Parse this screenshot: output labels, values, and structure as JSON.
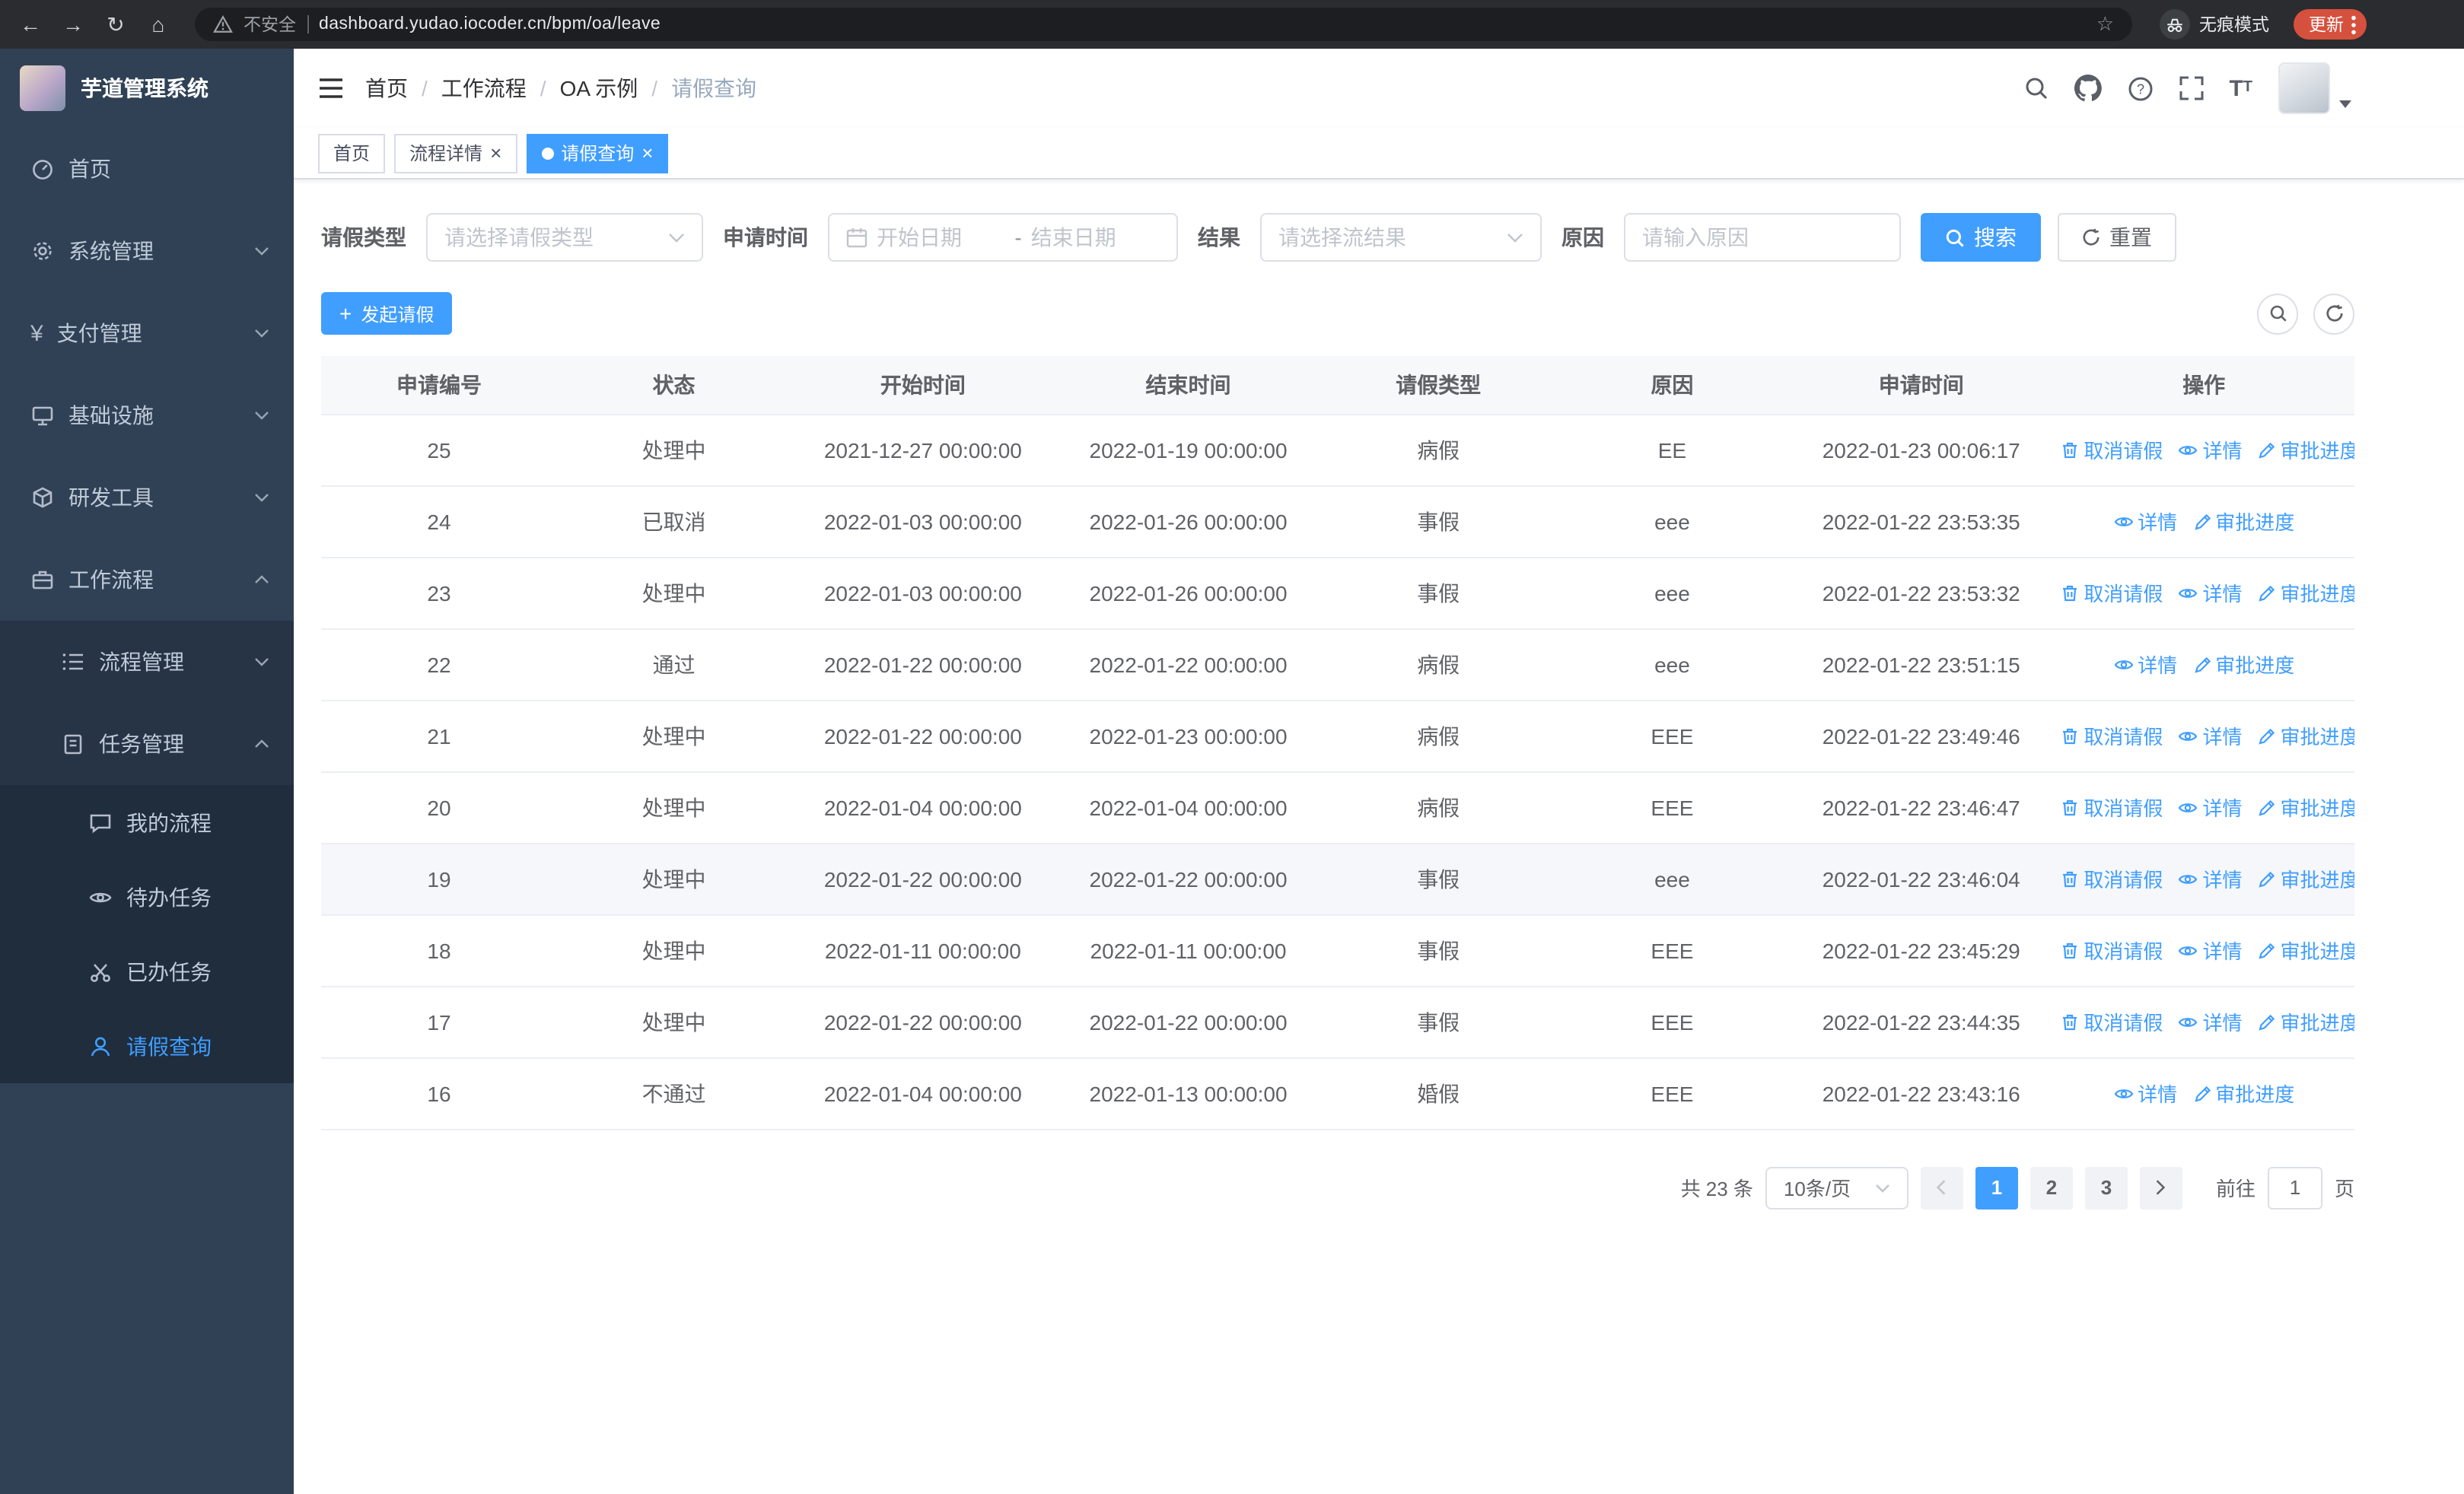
{
  "colors": {
    "accent": "#409eff",
    "sidebar_bg": "#304156",
    "sidebar_submenu_bg": "#263445",
    "sidebar_subsub_bg": "#1f2d3d",
    "update_pill": "#d6503e",
    "table_header_bg": "#f7f8fa"
  },
  "browser": {
    "security_label": "不安全",
    "url": "dashboard.yudao.iocoder.cn/bpm/oa/leave",
    "incognito_label": "无痕模式",
    "update_label": "更新"
  },
  "sidebar": {
    "logo_title": "芋道管理系统",
    "items": [
      {
        "label": "首页"
      },
      {
        "label": "系统管理"
      },
      {
        "label": "支付管理"
      },
      {
        "label": "基础设施"
      },
      {
        "label": "研发工具"
      },
      {
        "label": "工作流程"
      }
    ],
    "workflow_children": [
      {
        "label": "流程管理"
      },
      {
        "label": "任务管理"
      }
    ],
    "task_children": [
      {
        "label": "我的流程"
      },
      {
        "label": "待办任务"
      },
      {
        "label": "已办任务"
      },
      {
        "label": "请假查询"
      }
    ]
  },
  "header": {
    "breadcrumb": [
      "首页",
      "工作流程",
      "OA 示例",
      "请假查询"
    ]
  },
  "tabs": [
    {
      "label": "首页"
    },
    {
      "label": "流程详情"
    },
    {
      "label": "请假查询"
    }
  ],
  "filters": {
    "leave_type_label": "请假类型",
    "leave_type_placeholder": "请选择请假类型",
    "apply_time_label": "申请时间",
    "start_date_placeholder": "开始日期",
    "date_separator": "-",
    "end_date_placeholder": "结束日期",
    "result_label": "结果",
    "result_placeholder": "请选择流结果",
    "reason_label": "原因",
    "reason_placeholder": "请输入原因",
    "search_button": "搜索",
    "reset_button": "重置"
  },
  "toolbar": {
    "create_button": "发起请假"
  },
  "table": {
    "columns": [
      "申请编号",
      "状态",
      "开始时间",
      "结束时间",
      "请假类型",
      "原因",
      "申请时间",
      "操作"
    ],
    "action_labels": {
      "cancel": "取消请假",
      "detail": "详情",
      "progress": "审批进度"
    },
    "rows": [
      {
        "id": "25",
        "status": "处理中",
        "start": "2021-12-27 00:00:00",
        "end": "2022-01-19 00:00:00",
        "type": "病假",
        "reason": "EE",
        "applied": "2022-01-23 00:06:17",
        "actions": [
          "cancel",
          "detail",
          "progress"
        ],
        "highlighted": false
      },
      {
        "id": "24",
        "status": "已取消",
        "start": "2022-01-03 00:00:00",
        "end": "2022-01-26 00:00:00",
        "type": "事假",
        "reason": "eee",
        "applied": "2022-01-22 23:53:35",
        "actions": [
          "detail",
          "progress"
        ],
        "highlighted": false
      },
      {
        "id": "23",
        "status": "处理中",
        "start": "2022-01-03 00:00:00",
        "end": "2022-01-26 00:00:00",
        "type": "事假",
        "reason": "eee",
        "applied": "2022-01-22 23:53:32",
        "actions": [
          "cancel",
          "detail",
          "progress"
        ],
        "highlighted": false
      },
      {
        "id": "22",
        "status": "通过",
        "start": "2022-01-22 00:00:00",
        "end": "2022-01-22 00:00:00",
        "type": "病假",
        "reason": "eee",
        "applied": "2022-01-22 23:51:15",
        "actions": [
          "detail",
          "progress"
        ],
        "highlighted": false
      },
      {
        "id": "21",
        "status": "处理中",
        "start": "2022-01-22 00:00:00",
        "end": "2022-01-23 00:00:00",
        "type": "病假",
        "reason": "EEE",
        "applied": "2022-01-22 23:49:46",
        "actions": [
          "cancel",
          "detail",
          "progress"
        ],
        "highlighted": false
      },
      {
        "id": "20",
        "status": "处理中",
        "start": "2022-01-04 00:00:00",
        "end": "2022-01-04 00:00:00",
        "type": "病假",
        "reason": "EEE",
        "applied": "2022-01-22 23:46:47",
        "actions": [
          "cancel",
          "detail",
          "progress"
        ],
        "highlighted": false
      },
      {
        "id": "19",
        "status": "处理中",
        "start": "2022-01-22 00:00:00",
        "end": "2022-01-22 00:00:00",
        "type": "事假",
        "reason": "eee",
        "applied": "2022-01-22 23:46:04",
        "actions": [
          "cancel",
          "detail",
          "progress"
        ],
        "highlighted": true
      },
      {
        "id": "18",
        "status": "处理中",
        "start": "2022-01-11 00:00:00",
        "end": "2022-01-11 00:00:00",
        "type": "事假",
        "reason": "EEE",
        "applied": "2022-01-22 23:45:29",
        "actions": [
          "cancel",
          "detail",
          "progress"
        ],
        "highlighted": false
      },
      {
        "id": "17",
        "status": "处理中",
        "start": "2022-01-22 00:00:00",
        "end": "2022-01-22 00:00:00",
        "type": "事假",
        "reason": "EEE",
        "applied": "2022-01-22 23:44:35",
        "actions": [
          "cancel",
          "detail",
          "progress"
        ],
        "highlighted": false
      },
      {
        "id": "16",
        "status": "不通过",
        "start": "2022-01-04 00:00:00",
        "end": "2022-01-13 00:00:00",
        "type": "婚假",
        "reason": "EEE",
        "applied": "2022-01-22 23:43:16",
        "actions": [
          "detail",
          "progress"
        ],
        "highlighted": false
      }
    ]
  },
  "pagination": {
    "total_label": "共 23 条",
    "page_size_label": "10条/页",
    "pages": [
      "1",
      "2",
      "3"
    ],
    "active_page": "1",
    "goto_label": "前往",
    "goto_value": "1",
    "unit_label": "页"
  }
}
